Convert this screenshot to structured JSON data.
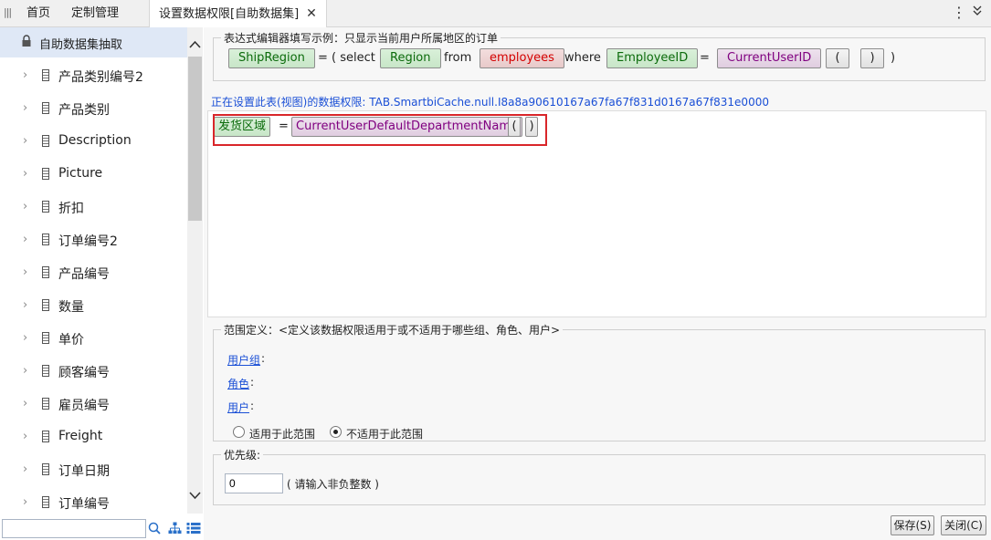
{
  "tabs": {
    "home": "首页",
    "custom": "定制管理",
    "current": "设置数据权限[自助数据集]",
    "close": "✕"
  },
  "tree": {
    "root": "自助数据集抽取",
    "items": [
      "产品类别编号2",
      "产品类别",
      "Description",
      "Picture",
      "折扣",
      "订单编号2",
      "产品编号",
      "数量",
      "单价",
      "顾客编号",
      "雇员编号",
      "Freight",
      "订单日期",
      "订单编号"
    ],
    "search_placeholder": ""
  },
  "example": {
    "legend": "表达式编辑器填写示例：只显示当前用户所属地区的订单",
    "ship_region": "ShipRegion",
    "eq1": "=",
    "open_select": "( select",
    "region": "Region",
    "from": "from",
    "employees": "employees",
    "where": "where",
    "employee_id": "EmployeeID",
    "eq2": "=",
    "current_user_id": "CurrentUserID",
    "lparen": "(",
    "rparen": ")",
    "close": ")"
  },
  "status_line": "正在设置此表(视图)的数据权限: TAB.SmartbiCache.null.I8a8a90610167a67fa67f831d0167a67f831e0000",
  "expression": {
    "field": "发货区域",
    "eq": "=",
    "func": "CurrentUserDefaultDepartmentName",
    "lparen": "(",
    "rparen": ")"
  },
  "scope": {
    "legend": "范围定义：<定义该数据权限适用于或不适用于哪些组、角色、用户>",
    "user_group": "用户组",
    "role": "角色",
    "user": "用户",
    "colon": ":",
    "apply_label": "适用于此范围",
    "not_apply_label": "不适用于此范围",
    "selected": "not_apply"
  },
  "priority": {
    "legend": "优先级:",
    "value": "0",
    "hint": "( 请输入非负整数 )"
  },
  "buttons": {
    "save": "保存(S)",
    "close": "关闭(C)"
  }
}
